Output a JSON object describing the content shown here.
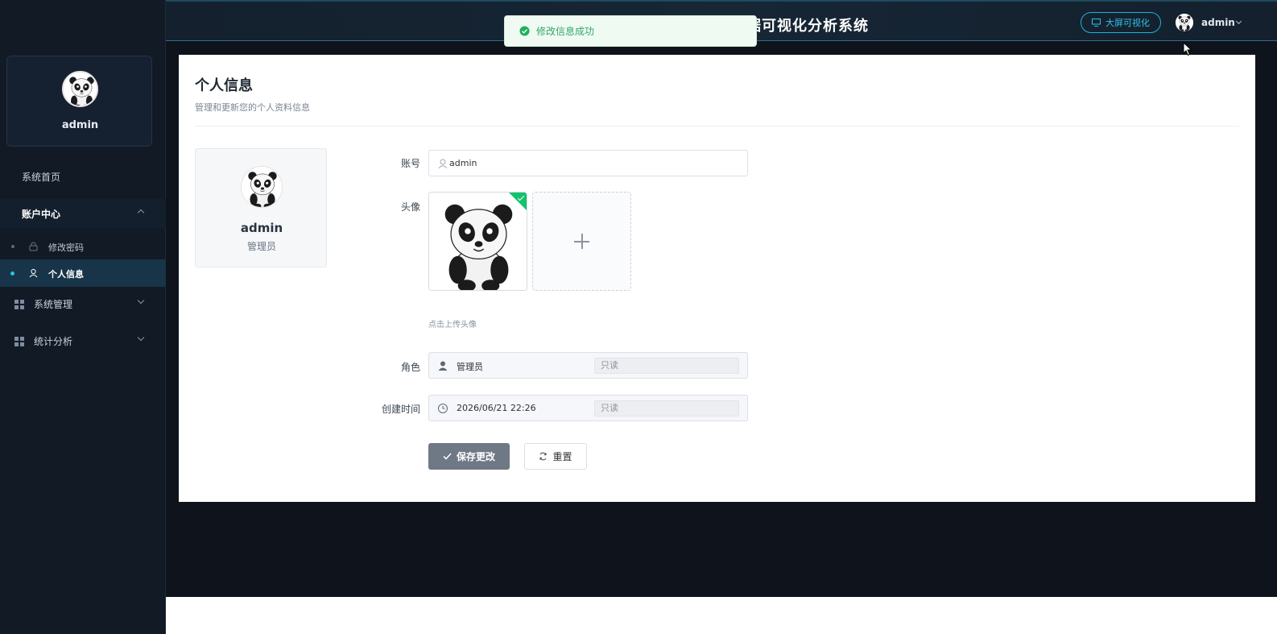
{
  "header": {
    "title_visible": "据可视化分析系统",
    "bigscreen_label": "大屏可视化",
    "username": "admin"
  },
  "toast": {
    "message": "修改信息成功"
  },
  "sidebar": {
    "profile_name": "admin",
    "items": [
      {
        "label": "系统首页"
      },
      {
        "label": "账户中心"
      },
      {
        "label": "修改密码"
      },
      {
        "label": "个人信息"
      },
      {
        "label": "系统管理"
      },
      {
        "label": "统计分析"
      }
    ]
  },
  "page": {
    "title": "个人信息",
    "subtitle": "管理和更新您的个人资料信息"
  },
  "profile_card": {
    "name": "admin",
    "role": "管理员"
  },
  "form": {
    "account_label": "账号",
    "account_value": "admin",
    "avatar_label": "头像",
    "upload_hint": "点击上传头像",
    "role_label": "角色",
    "role_value": "管理员",
    "role_readonly": "只读",
    "created_label": "创建时间",
    "created_value": "2026/06/21 22:26",
    "created_readonly": "只读",
    "save_label": "保存更改",
    "reset_label": "重置"
  },
  "colors": {
    "sidebar_bg": "#121a26",
    "accent": "#29c2e6",
    "success": "#13c26b"
  }
}
